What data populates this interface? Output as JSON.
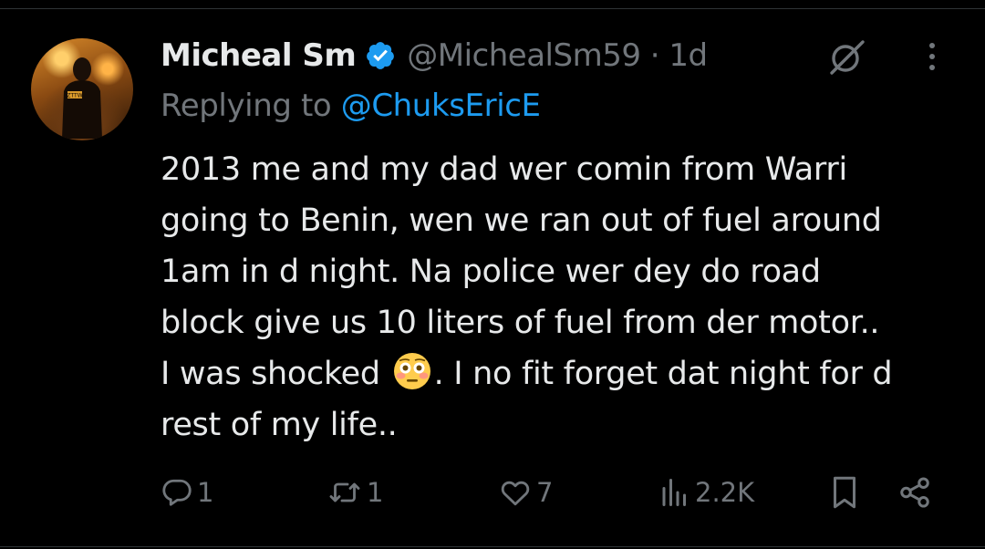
{
  "tweet": {
    "author": {
      "name": "Micheal Sm",
      "handle": "@MichealSm59",
      "separator": "·",
      "time": "1d"
    },
    "replying_label": "Replying to",
    "replying_to": "@ChuksEricE",
    "text_lines": [
      "2013 me and my dad wer comin from Warri",
      "going to Benin, wen we ran out of fuel around",
      "1am in d night. Na police wer dey do road",
      "block give us 10 liters of fuel from der motor..",
      "I was shocked",
      ". I no fit forget dat night for d",
      "rest of my life.."
    ],
    "emoji": "flushed-face-emoji",
    "avatar_text": "ZTTW"
  },
  "actions": {
    "replies": "1",
    "reposts": "1",
    "likes": "7",
    "views": "2.2K"
  },
  "icons": [
    "verified-badge-icon",
    "grok-icon",
    "more-icon",
    "reply-icon",
    "repost-icon",
    "like-icon",
    "views-icon",
    "bookmark-icon",
    "share-icon"
  ],
  "colors": {
    "background": "#000000",
    "text": "#e7e9ea",
    "secondary": "#71767b",
    "accent": "#1d9bf0"
  }
}
